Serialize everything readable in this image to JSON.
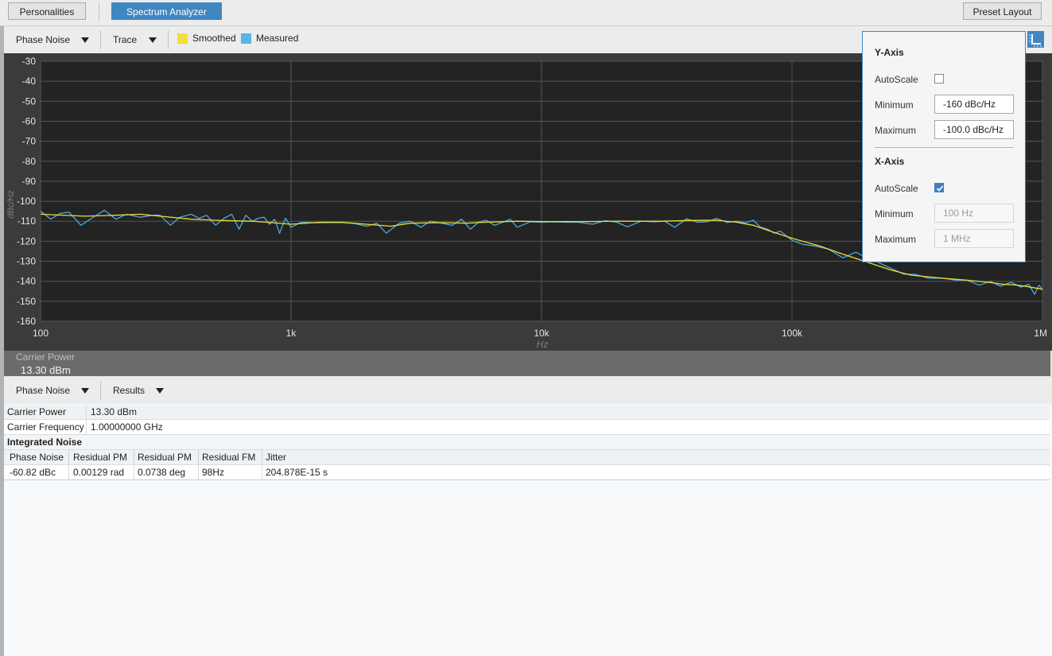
{
  "topbar": {
    "personalities_label": "Personalities",
    "spectrum_analyzer_label": "Spectrum Analyzer",
    "preset_layout_label": "Preset Layout"
  },
  "plot_toolbar": {
    "measurement_label": "Phase Noise",
    "view_label": "Trace",
    "legend": [
      {
        "label": "Smoothed",
        "color": "#f0e03a"
      },
      {
        "label": "Measured",
        "color": "#57b4e8"
      }
    ],
    "axis_settings_icon": "axis-settings-icon"
  },
  "carrier_bar": {
    "label": "Carrier Power",
    "value": "13.30 dBm"
  },
  "axis_popup": {
    "y_axis": {
      "heading": "Y-Axis",
      "autoscale_label": "AutoScale",
      "autoscale_checked": false,
      "minimum_label": "Minimum",
      "minimum_value": "-160 dBc/Hz",
      "maximum_label": "Maximum",
      "maximum_value": "-100.0 dBc/Hz"
    },
    "x_axis": {
      "heading": "X-Axis",
      "autoscale_label": "AutoScale",
      "autoscale_checked": true,
      "minimum_label": "Minimum",
      "minimum_value": "100 Hz",
      "maximum_label": "Maximum",
      "maximum_value": "1 MHz"
    }
  },
  "results_toolbar": {
    "measurement_label": "Phase Noise",
    "view_label": "Results"
  },
  "results": {
    "summary": [
      {
        "label": "Carrier Power",
        "value": "13.30 dBm"
      },
      {
        "label": "Carrier Frequency",
        "value": "1.00000000 GHz"
      }
    ],
    "section_title": "Integrated Noise",
    "columns": [
      "Phase Noise",
      "Residual PM",
      "Residual PM",
      "Residual FM",
      "Jitter"
    ],
    "rows": [
      [
        "-60.82 dBc",
        "0.00129 rad",
        "0.0738 deg",
        "98Hz",
        "204.878E-15 s"
      ]
    ]
  },
  "chart_data": {
    "type": "line",
    "title": "",
    "xlabel": "Hz",
    "ylabel": "dBc/Hz",
    "xscale": "log",
    "xlim": [
      100,
      1000000
    ],
    "ylim": [
      -160,
      -30
    ],
    "grid": true,
    "legend_position": "top-left toolbar",
    "x_ticks": [
      100,
      1000,
      10000,
      100000,
      1000000
    ],
    "x_tick_labels": [
      "100",
      "1k",
      "10k",
      "100k",
      "1M"
    ],
    "y_ticks": [
      -30,
      -40,
      -50,
      -60,
      -70,
      -80,
      -90,
      -100,
      -110,
      -120,
      -130,
      -140,
      -150,
      -160
    ],
    "y_tick_labels": [
      "-30",
      "-40",
      "-50",
      "-60",
      "-70",
      "-80",
      "-90",
      "-100",
      "-110",
      "-120",
      "-130",
      "-140",
      "-150",
      "-160"
    ],
    "series": [
      {
        "name": "Smoothed",
        "color": "#e8dc3a",
        "x": [
          100,
          150,
          200,
          250,
          300,
          400,
          500,
          600,
          700,
          800,
          1000,
          1300,
          1600,
          2000,
          2500,
          3000,
          4000,
          5000,
          6000,
          8000,
          10000,
          15000,
          20000,
          30000,
          40000,
          50000,
          60000,
          70000,
          80000,
          100000,
          130000,
          160000,
          200000,
          250000,
          300000,
          400000,
          500000,
          600000,
          700000,
          800000,
          900000,
          1000000
        ],
        "y": [
          -106.5,
          -107.5,
          -107,
          -106.5,
          -107.5,
          -109,
          -109.5,
          -109.8,
          -110,
          -110.5,
          -111.5,
          -110.5,
          -110.5,
          -111.5,
          -112.5,
          -111,
          -110.7,
          -111,
          -110.5,
          -110,
          -110.2,
          -110.2,
          -110,
          -110,
          -109.6,
          -109.5,
          -110.5,
          -112,
          -114.5,
          -118.5,
          -122.5,
          -126.5,
          -130.5,
          -134.5,
          -137,
          -138.5,
          -139.5,
          -140.5,
          -141.5,
          -142,
          -143,
          -144
        ]
      },
      {
        "name": "Measured",
        "color": "#4fa8dc",
        "x": [
          100,
          110,
          120,
          130,
          145,
          160,
          180,
          200,
          220,
          250,
          280,
          300,
          330,
          360,
          400,
          430,
          460,
          500,
          540,
          580,
          620,
          660,
          700,
          740,
          780,
          820,
          860,
          900,
          950,
          1000,
          1100,
          1250,
          1400,
          1600,
          1800,
          2000,
          2200,
          2400,
          2700,
          3000,
          3300,
          3600,
          4000,
          4400,
          4800,
          5200,
          5600,
          6000,
          6500,
          7000,
          7500,
          8000,
          9000,
          10000,
          11000,
          12500,
          14000,
          16000,
          18000,
          20000,
          22000,
          25000,
          28000,
          31000,
          34000,
          38000,
          42000,
          46000,
          50000,
          55000,
          60000,
          65000,
          70000,
          75000,
          80000,
          85000,
          90000,
          100000,
          110000,
          125000,
          140000,
          160000,
          180000,
          200000,
          220000,
          250000,
          280000,
          310000,
          350000,
          400000,
          450000,
          500000,
          560000,
          620000,
          680000,
          750000,
          820000,
          880000,
          930000,
          970000,
          1000000
        ],
        "y": [
          -105,
          -109,
          -106,
          -105.5,
          -112,
          -108.5,
          -104.5,
          -109,
          -106.5,
          -108,
          -107,
          -107,
          -112,
          -108,
          -106.5,
          -108.5,
          -107,
          -112,
          -108.5,
          -106.5,
          -114,
          -107,
          -110,
          -108.5,
          -108,
          -111.5,
          -109,
          -116,
          -108.5,
          -113,
          -110.5,
          -110.8,
          -110.7,
          -110.7,
          -111.2,
          -112.5,
          -111,
          -116,
          -111,
          -110,
          -113,
          -110,
          -111,
          -112,
          -109,
          -114,
          -110.5,
          -109.5,
          -112,
          -110.5,
          -109,
          -113,
          -110.3,
          -110.5,
          -110.3,
          -110.5,
          -110.5,
          -111.5,
          -109.7,
          -110.5,
          -112.8,
          -110,
          -110.3,
          -110,
          -113,
          -108.8,
          -110.5,
          -110.2,
          -108.6,
          -110.6,
          -110,
          -110.8,
          -109.5,
          -113,
          -114,
          -116,
          -115,
          -119.5,
          -121.5,
          -122.5,
          -124,
          -128.3,
          -125.5,
          -128.5,
          -130.5,
          -133.7,
          -136.5,
          -136.5,
          -138.5,
          -138.5,
          -139.5,
          -139.5,
          -142,
          -140,
          -142.5,
          -140.5,
          -143,
          -141.5,
          -146.5,
          -142,
          -144
        ]
      }
    ]
  }
}
